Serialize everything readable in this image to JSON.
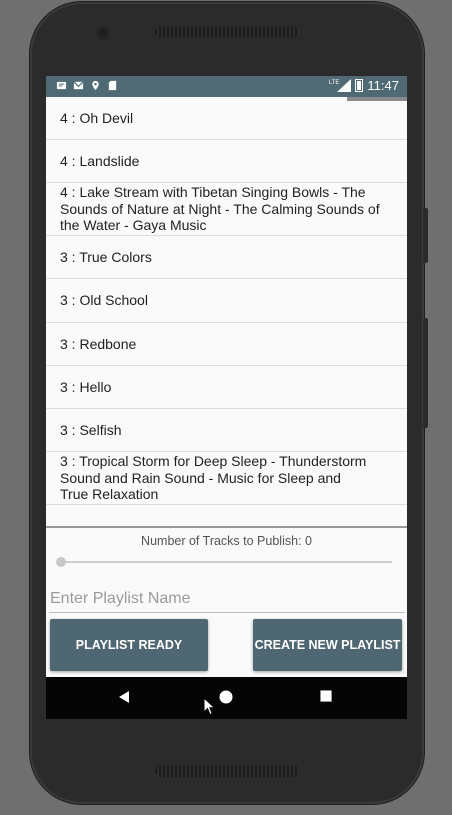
{
  "status_bar": {
    "time": "11:47",
    "network_label": "LTE",
    "left_icons": [
      "message-icon",
      "gmail-icon",
      "location-icon",
      "sd-card-icon"
    ]
  },
  "tracks": [
    {
      "label": "4 : Oh Devil"
    },
    {
      "label": "4 : Landslide"
    },
    {
      "label": "4 : Lake Stream with Tibetan Singing Bowls - The Sounds of Nature at Night - The Calming Sounds of the Water - Gaya Music"
    },
    {
      "label": "3 : True Colors"
    },
    {
      "label": "3 : Old School"
    },
    {
      "label": "3 : Redbone"
    },
    {
      "label": "3 : Hello"
    },
    {
      "label": "3 : Selfish"
    },
    {
      "label": "3 : Tropical Storm for Deep Sleep - Thunderstorm Sound and Rain Sound - Music for Sleep and True Relaxation"
    }
  ],
  "publish": {
    "label": "Number of Tracks to Publish: 0",
    "value": 0
  },
  "playlist_input": {
    "placeholder": "Enter Playlist Name",
    "value": ""
  },
  "buttons": {
    "playlist_ready": "PLAYLIST READY",
    "create_new_playlist": "CREATE NEW PLAYLIST"
  },
  "nav_bar": [
    "back-icon",
    "home-icon",
    "recents-icon"
  ],
  "colors": {
    "status_bar": "#4f6a74",
    "button": "#4f6772",
    "nav_bar": "#050505"
  }
}
